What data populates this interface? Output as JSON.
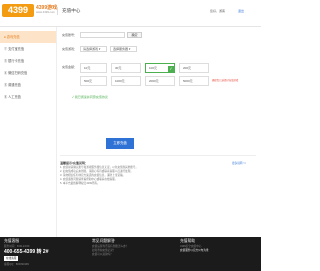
{
  "header": {
    "logo_text": "4399",
    "logo_sub": "4399游戏",
    "logo_url": "www.4399.com",
    "page_title": "充值中心",
    "user_text": "您好，游客",
    "logout_text": "退出"
  },
  "sidebar": {
    "items": [
      {
        "label": "● 游戏充值"
      },
      {
        "label": "① 支付宝充值"
      },
      {
        "label": "③ 银行卡充值"
      },
      {
        "label": "④ 微信扫码充值"
      },
      {
        "label": "⑤ 普通充值"
      },
      {
        "label": "⑥ 人工充值"
      }
    ]
  },
  "form": {
    "account_label": "充值账号：",
    "account_value": "",
    "confirm_label": "确定",
    "game_label": "充值游戏：",
    "game_select_1": "请选择游戏 ▾",
    "game_select_2": "选择服务器 ▾",
    "amount_label": "充值金额：",
    "amounts": [
      "10元",
      "30元",
      "100元",
      "200元",
      "500元",
      "1000元",
      "2000元",
      "5000元"
    ],
    "amount_note": "确保您已选择好充值游戏",
    "protocol_text": "✓ 我已阅读并同意充值协议",
    "pay_button": "立即充值"
  },
  "notes": {
    "title": "温馨提示/充值说明：",
    "more_link": "更多说明 >>",
    "lines": [
      "1. 充值前请确认账号和游戏服务器信息无误，以免充值到其他账号。",
      "2. 如充值成功后未到账，请耐心等待或联系客服人员进行处理。",
      "3. 请勿相信任何非官方渠道的充值信息，谨防上当受骗。",
      "4. 充值遇到问题请查看帮助中心或联系在线客服。",
      "5. 本平台最终解释权归4399所有。"
    ]
  },
  "footer": {
    "col1_title": "充值客服",
    "col1_sub": "服务时间：8:00-24:00",
    "phone": "400-655-4399 转 2#",
    "badge": "在线客服",
    "col1_bottom": "客服QQ：800094399",
    "col2_title": "常见问题解答",
    "col2_lines": [
      "充值后游戏币没有到账怎么办？",
      "如何查询充值记录？",
      "充值可以退款吗？"
    ],
    "col3_title": "充值帮助",
    "col3_lines": [
      "4399安全充值中心",
      "充值服务以官方公布为准"
    ]
  }
}
